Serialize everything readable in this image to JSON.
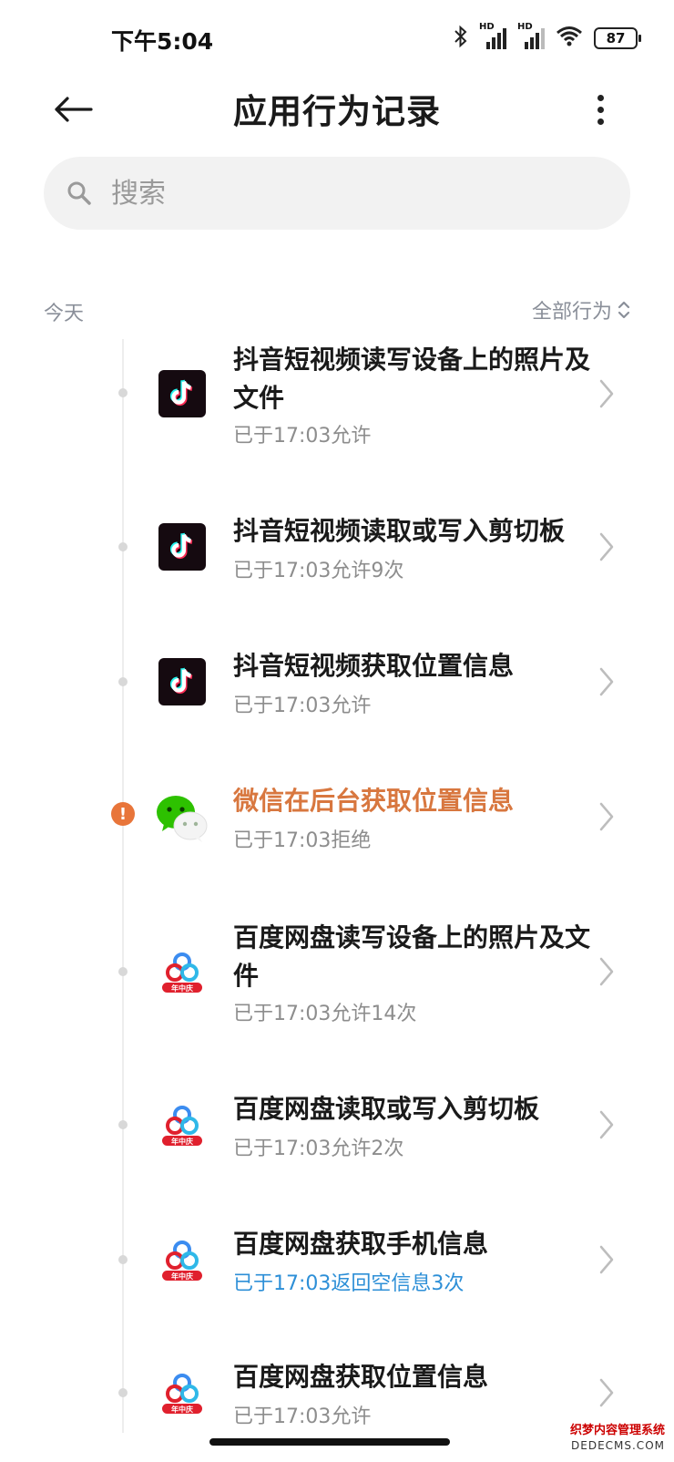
{
  "status_bar": {
    "time": "下午5:04",
    "battery": "87",
    "hd1": "HD",
    "hd2": "HD"
  },
  "header": {
    "title": "应用行为记录"
  },
  "search": {
    "placeholder": "搜索"
  },
  "section": {
    "today": "今天",
    "filter": "全部行为"
  },
  "items": [
    {
      "app": "tiktok",
      "title": "抖音短视频读写设备上的照片及文件",
      "sub": "已于17:03允许"
    },
    {
      "app": "tiktok",
      "title": "抖音短视频读取或写入剪切板",
      "sub": "已于17:03允许9次"
    },
    {
      "app": "tiktok",
      "title": "抖音短视频获取位置信息",
      "sub": "已于17:03允许"
    },
    {
      "app": "wechat",
      "title": "微信在后台获取位置信息",
      "sub": "已于17:03拒绝",
      "warning": true
    },
    {
      "app": "baidu",
      "title": "百度网盘读写设备上的照片及文件",
      "sub": "已于17:03允许14次"
    },
    {
      "app": "baidu",
      "title": "百度网盘读取或写入剪切板",
      "sub": "已于17:03允许2次"
    },
    {
      "app": "baidu",
      "title": "百度网盘获取手机信息",
      "sub": "已于17:03返回空信息3次"
    },
    {
      "app": "baidu",
      "title": "百度网盘获取位置信息",
      "sub": "已于17:03允许"
    }
  ],
  "baidu_badge": "年中庆",
  "watermark": {
    "line1": "织梦内容管理系统",
    "line2": "DEDECMS.COM"
  },
  "colors": {
    "warning": "#d8773f",
    "info_blue": "#2d8fd7",
    "wechat_green": "#2dc100",
    "baidu_red": "#e0202d"
  }
}
